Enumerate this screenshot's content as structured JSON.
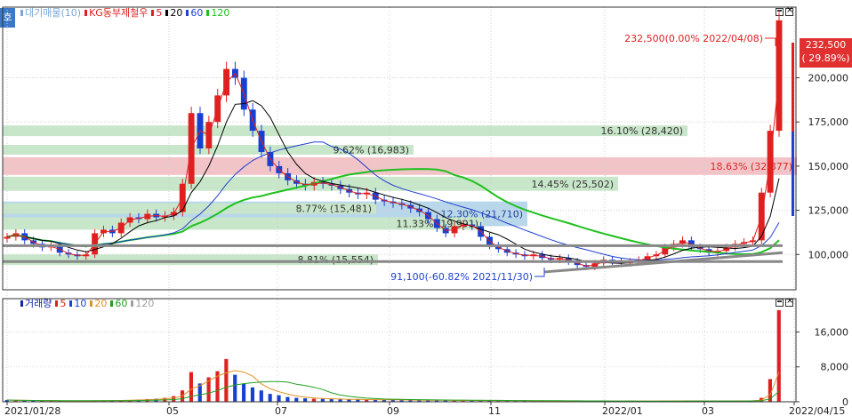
{
  "side_tab": "호",
  "price_legend": [
    {
      "label": "대기매물(10)",
      "color": "#7aa7d8"
    },
    {
      "label": "KG동부제철우",
      "color": "#e02020"
    },
    {
      "label": "5",
      "color": "#e02020"
    },
    {
      "label": "20",
      "color": "#000000"
    },
    {
      "label": "60",
      "color": "#2040d0"
    },
    {
      "label": "120",
      "color": "#20c020"
    }
  ],
  "volume_legend": [
    {
      "label": "거래량",
      "color": "#1020b0"
    },
    {
      "label": "5",
      "color": "#e02020"
    },
    {
      "label": "10",
      "color": "#2040d0"
    },
    {
      "label": "20",
      "color": "#e09020"
    },
    {
      "label": "60",
      "color": "#20a020"
    },
    {
      "label": "120",
      "color": "#a0a0a0"
    }
  ],
  "current_price": {
    "value": "232,500",
    "change": "( 29.89%)"
  },
  "annotations": {
    "high": "232,500(0.00% 2022/04/08)",
    "low": "91,100(-60.82% 2021/11/30)"
  },
  "colors": {
    "up": "#e02020",
    "down": "#1840d0",
    "ma5": "#e02020",
    "ma20": "#000000",
    "ma60": "#2040d0",
    "ma120": "#20c020",
    "band_blue": "#b9d7ea",
    "band_green": "#c8e6c9",
    "band_red": "#f2c4c8"
  },
  "chart_data": [
    {
      "type": "candlestick",
      "title": "KG동부제철우",
      "x_labels": [
        "2021/01/28",
        "05",
        "07",
        "09",
        "11",
        "2022/01",
        "03",
        "2022/04/15"
      ],
      "ylim": [
        80000,
        240000
      ],
      "yticks": [
        "100,000",
        "125,000",
        "150,000",
        "175,000",
        "200,000"
      ],
      "volume_profile": [
        {
          "pct": "12.30%",
          "qty": "(21,710)",
          "price_lo": 116000,
          "price_hi": 130000,
          "color": "band_blue"
        },
        {
          "pct": "16.10%",
          "qty": "(28,420)",
          "price_lo": 167000,
          "price_hi": 173000,
          "color": "band_green"
        },
        {
          "pct": "9.62%",
          "qty": "(16,983)",
          "price_lo": 156500,
          "price_hi": 162000,
          "color": "band_green"
        },
        {
          "pct": "18.63%",
          "qty": "(32,877)",
          "price_lo": 145000,
          "price_hi": 155000,
          "color": "band_red"
        },
        {
          "pct": "14.45%",
          "qty": "(25,502)",
          "price_lo": 136000,
          "price_hi": 144000,
          "color": "band_green"
        },
        {
          "pct": "8.77%",
          "qty": "(15,481)",
          "price_lo": 123000,
          "price_hi": 129000,
          "color": "band_green"
        },
        {
          "pct": "11.33%",
          "qty": "(19,991)",
          "price_lo": 114000,
          "price_hi": 121000,
          "color": "band_green"
        },
        {
          "pct": "8.81%",
          "qty": "(15,554)",
          "price_lo": 94000,
          "price_hi": 100000,
          "color": "band_green"
        }
      ],
      "close": [
        110000,
        112000,
        108000,
        106000,
        104000,
        105000,
        101000,
        100000,
        99000,
        100000,
        112000,
        114000,
        112000,
        118000,
        121000,
        120000,
        123000,
        121000,
        122000,
        124000,
        140000,
        180000,
        160000,
        175000,
        190000,
        205000,
        200000,
        182000,
        170000,
        158000,
        150000,
        146000,
        142000,
        140000,
        139000,
        141000,
        140000,
        139000,
        137000,
        135000,
        134000,
        135000,
        131000,
        130000,
        129000,
        128000,
        126000,
        124000,
        120000,
        115000,
        112000,
        116000,
        117000,
        116000,
        110000,
        105000,
        103000,
        101000,
        100000,
        99000,
        100000,
        98000,
        97000,
        98000,
        96000,
        94000,
        93000,
        95000,
        97000,
        96000,
        95000,
        96000,
        97000,
        99000,
        100000,
        104000,
        106000,
        108000,
        104000,
        103000,
        101000,
        102000,
        104000,
        106000,
        107000,
        108000,
        135000,
        170000,
        232500
      ],
      "ma_lines": [
        "ma5",
        "ma20",
        "ma60",
        "ma120"
      ],
      "support_lines": [
        105000,
        96000
      ]
    },
    {
      "type": "bar",
      "title": "거래량",
      "yticks": [
        "16,000",
        "8,000",
        "0"
      ],
      "ylim": [
        0,
        22000
      ],
      "values": [
        400,
        300,
        300,
        250,
        220,
        210,
        200,
        190,
        210,
        230,
        280,
        300,
        320,
        360,
        400,
        520,
        620,
        700,
        900,
        1300,
        2600,
        6800,
        4200,
        5600,
        7000,
        9800,
        6200,
        4200,
        3300,
        2600,
        1800,
        1500,
        1100,
        900,
        800,
        700,
        650,
        600,
        550,
        520,
        500,
        480,
        460,
        440,
        420,
        400,
        380,
        360,
        350,
        330,
        320,
        310,
        300,
        290,
        280,
        260,
        250,
        240,
        230,
        220,
        210,
        200,
        200,
        190,
        180,
        170,
        170,
        160,
        160,
        150,
        150,
        150,
        160,
        170,
        180,
        200,
        220,
        200,
        190,
        180,
        170,
        180,
        200,
        210,
        220,
        230,
        900,
        5200,
        21000
      ]
    }
  ]
}
